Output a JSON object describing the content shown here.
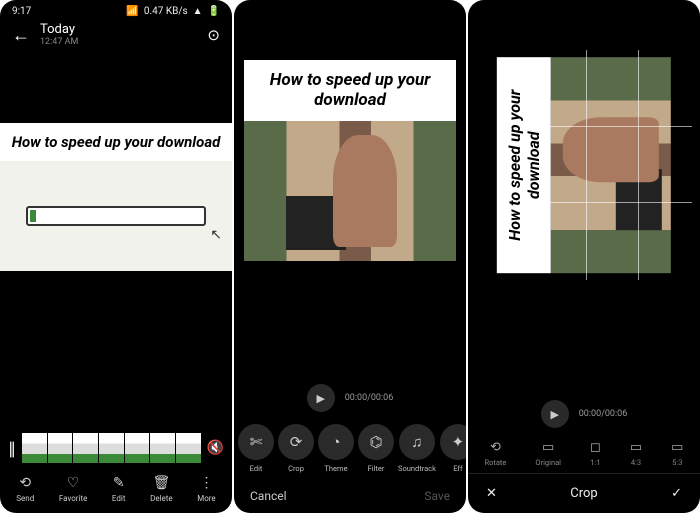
{
  "status": {
    "time": "9:17",
    "net": "0.47 KB/s",
    "battery": "50"
  },
  "panel1": {
    "title": "Today",
    "subtitle": "12:47 AM",
    "caption": "How to speed up your download",
    "actions": {
      "send": "Send",
      "favorite": "Favorite",
      "edit": "Edit",
      "delete": "Delete",
      "more": "More"
    }
  },
  "panel2": {
    "caption": "How to speed up your download",
    "time": "00:00/00:06",
    "tools": {
      "edit": "Edit",
      "crop": "Crop",
      "theme": "Theme",
      "filter": "Filter",
      "soundtrack": "Soundtrack",
      "effect": "Eff"
    },
    "cancel": "Cancel",
    "save": "Save"
  },
  "panel3": {
    "caption": "How to speed up your download",
    "time": "00:00/00:06",
    "opts": {
      "rotate": "Rotate",
      "original": "Original",
      "r11": "1:1",
      "r43": "4:3",
      "r53": "5:3"
    },
    "crop_label": "Crop"
  }
}
